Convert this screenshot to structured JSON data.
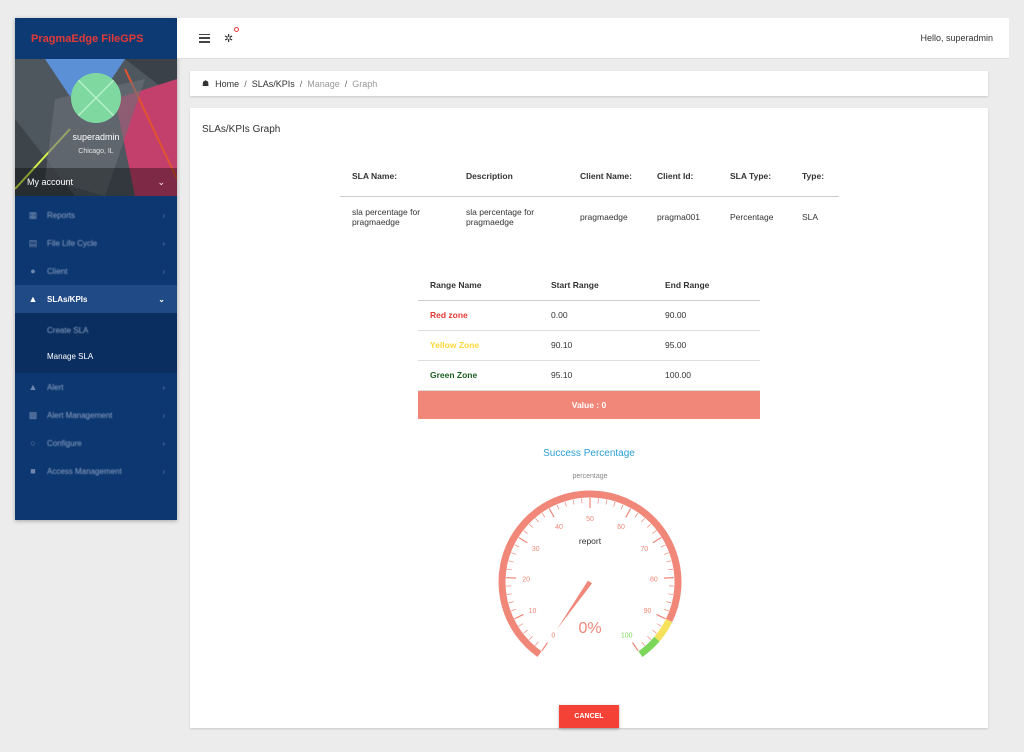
{
  "brand": "PragmaEdge FileGPS",
  "profile": {
    "name": "superadmin",
    "location": "Chicago, IL",
    "account_label": "My account"
  },
  "sidebar": {
    "items": [
      {
        "label": "Reports"
      },
      {
        "label": "File Life Cycle"
      },
      {
        "label": "Client"
      },
      {
        "label": "SLAs/KPIs"
      },
      {
        "label": "Alert"
      },
      {
        "label": "Alert Management"
      },
      {
        "label": "Configure"
      },
      {
        "label": "Access Management"
      }
    ],
    "submenu": [
      {
        "label": "Create SLA"
      },
      {
        "label": "Manage SLA"
      }
    ]
  },
  "topbar": {
    "greeting": "Hello, superadmin"
  },
  "breadcrumb": {
    "home": "Home",
    "slas": "SLAs/KPIs",
    "manage": "Manage",
    "graph": "Graph"
  },
  "page": {
    "title": "SLAs/KPIs Graph"
  },
  "sla_table": {
    "headers": [
      "SLA Name:",
      "Description",
      "Client Name:",
      "Client Id:",
      "SLA Type:",
      "Type:"
    ],
    "row": [
      "sla percentage for pragmaedge",
      "sla percentage for pragmaedge",
      "pragmaedge",
      "pragma001",
      "Percentage",
      "SLA"
    ]
  },
  "range_table": {
    "headers": [
      "Range Name",
      "Start Range",
      "End Range"
    ],
    "rows": [
      {
        "name": "Red zone",
        "start": "0.00",
        "end": "90.00"
      },
      {
        "name": "Yellow Zone",
        "start": "90.10",
        "end": "95.00"
      },
      {
        "name": "Green Zone",
        "start": "95.10",
        "end": "100.00"
      }
    ],
    "value_label": "Value : 0"
  },
  "gauge": {
    "title": "Success Percentage",
    "subtitle": "percentage",
    "center_label": "report",
    "value": 0,
    "value_text": "0%",
    "min": 0,
    "max": 100,
    "ticks": [
      "0",
      "10",
      "20",
      "30",
      "40",
      "50",
      "60",
      "70",
      "80",
      "90",
      "100"
    ],
    "bands": [
      {
        "from": 0,
        "to": 90,
        "color": "#f08778"
      },
      {
        "from": 90,
        "to": 95,
        "color": "#f5e25a"
      },
      {
        "from": 95,
        "to": 100,
        "color": "#7bd65a"
      }
    ]
  },
  "buttons": {
    "cancel": "CANCEL"
  },
  "colors": {
    "sidebar_bg": "#0d3770",
    "accent_red": "#e53935",
    "value_bar": "#f08778",
    "gauge_title": "#2a9fd6"
  }
}
